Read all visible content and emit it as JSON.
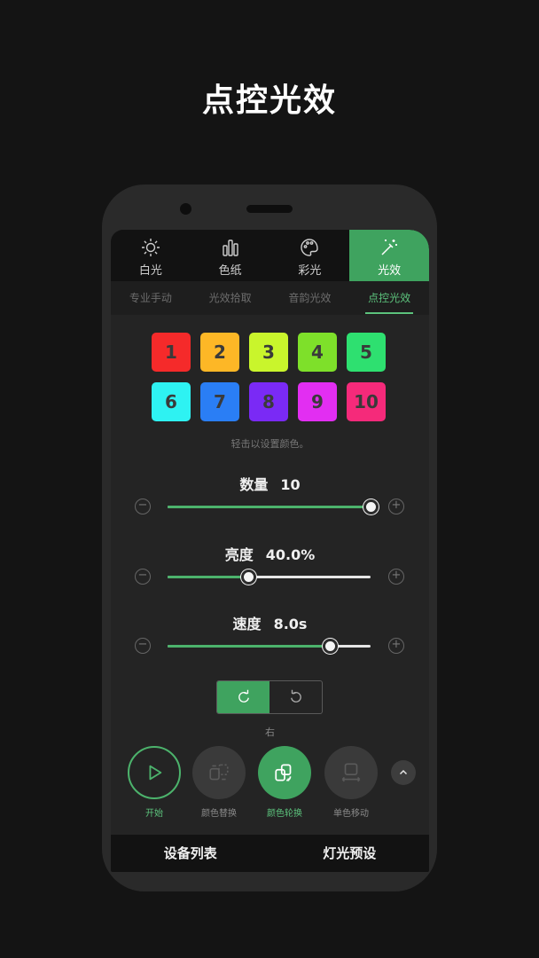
{
  "hero_title": "点控光效",
  "top_tabs": [
    {
      "label": "白光",
      "icon": "sun-icon"
    },
    {
      "label": "色纸",
      "icon": "bars-icon"
    },
    {
      "label": "彩光",
      "icon": "palette-icon"
    },
    {
      "label": "光效",
      "icon": "magic-wand-icon",
      "active": true
    }
  ],
  "sub_tabs": [
    {
      "label": "专业手动"
    },
    {
      "label": "光效拾取"
    },
    {
      "label": "音韵光效"
    },
    {
      "label": "点控光效",
      "active": true
    }
  ],
  "color_cells": [
    {
      "label": "1",
      "color": "#f52a2a"
    },
    {
      "label": "2",
      "color": "#fdb726"
    },
    {
      "label": "3",
      "color": "#c9f52c"
    },
    {
      "label": "4",
      "color": "#7ee02a"
    },
    {
      "label": "5",
      "color": "#2ee070"
    },
    {
      "label": "6",
      "color": "#2ef2f2"
    },
    {
      "label": "7",
      "color": "#2a7ef5"
    },
    {
      "label": "8",
      "color": "#7a2af5"
    },
    {
      "label": "9",
      "color": "#e22ef2"
    },
    {
      "label": "10",
      "color": "#f52a7a"
    }
  ],
  "hint": "轻击以设置颜色。",
  "sliders": {
    "count": {
      "label": "数量",
      "value": "10",
      "level": 1.0
    },
    "brightness": {
      "label": "亮度",
      "value": "40.0%",
      "level": 0.4
    },
    "speed": {
      "label": "速度",
      "value": "8.0s",
      "level": 0.8
    }
  },
  "direction": {
    "label": "右"
  },
  "modes": [
    {
      "label": "开始",
      "icon": "play-icon"
    },
    {
      "label": "颜色替换",
      "icon": "color-replace-icon"
    },
    {
      "label": "颜色轮换",
      "icon": "color-cycle-icon"
    },
    {
      "label": "单色移动",
      "icon": "mono-move-icon"
    }
  ],
  "bottom_bar": {
    "device_list": "设备列表",
    "presets": "灯光预设"
  },
  "colors": {
    "accent": "#3fa35f",
    "background": "#141414"
  }
}
